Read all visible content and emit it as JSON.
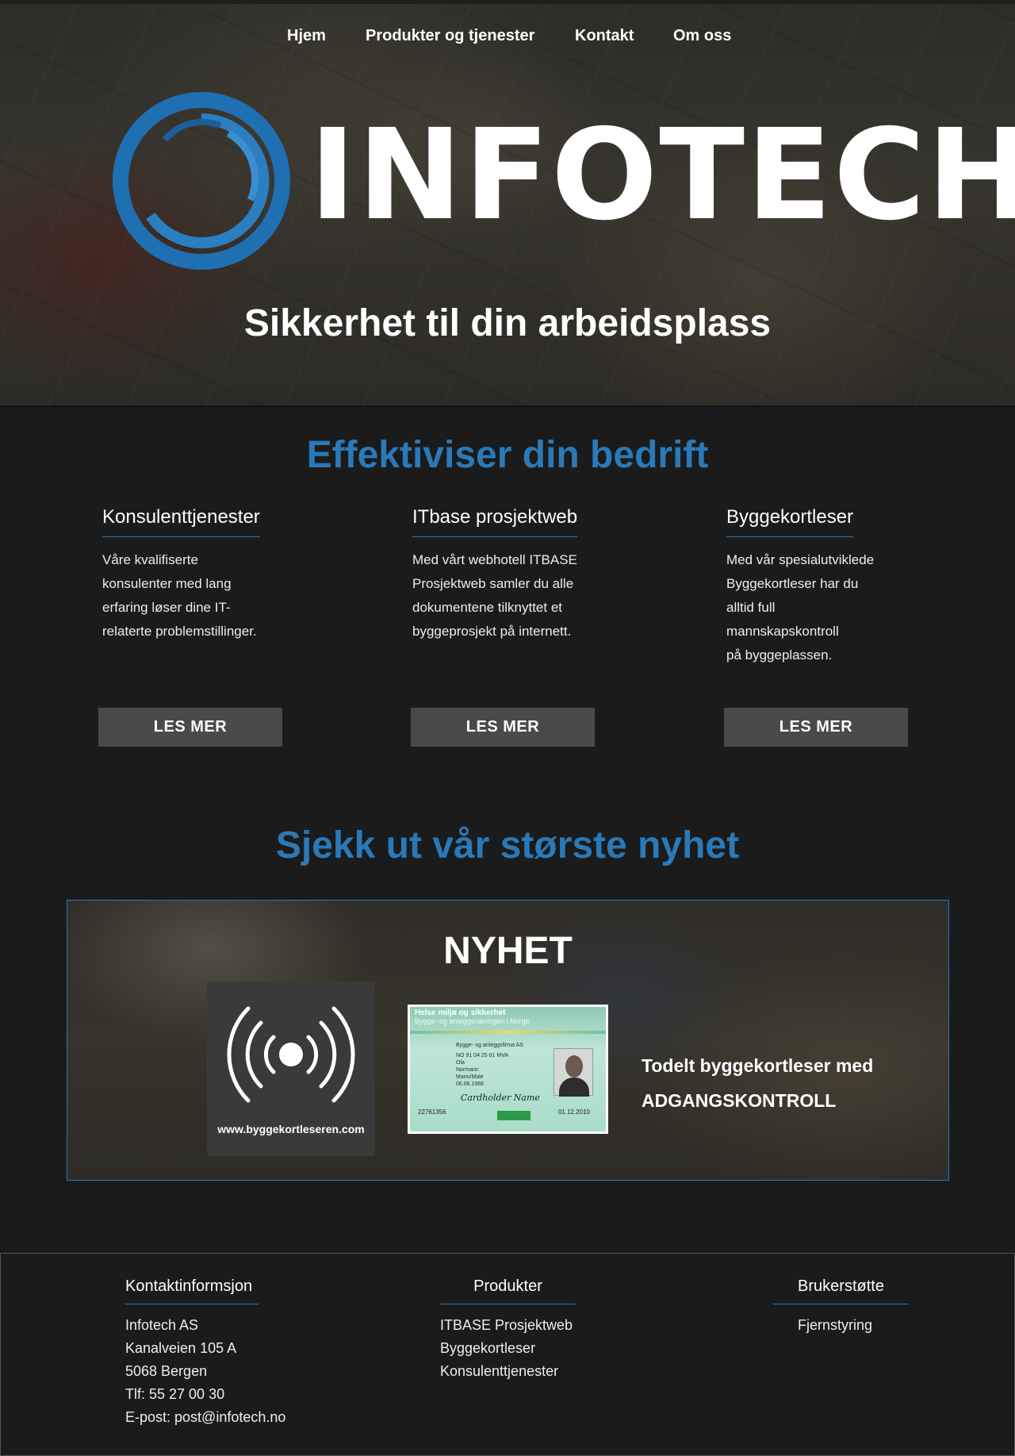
{
  "nav": {
    "items": [
      "Hjem",
      "Produkter og tjenester",
      "Kontakt",
      "Om oss"
    ]
  },
  "hero": {
    "logo_text": "INFOTECH",
    "tagline": "Sikkerhet til din arbeidsplass"
  },
  "services": {
    "title": "Effektiviser din bedrift",
    "items": [
      {
        "heading": "Konsulenttjenester",
        "lines": [
          "Våre kvalifiserte",
          "konsulenter med lang",
          "erfaring løser dine IT-",
          "relaterte problemstillinger."
        ],
        "button": "LES MER"
      },
      {
        "heading": "ITbase prosjektweb",
        "lines": [
          "Med vårt webhotell ITBASE",
          "Prosjektweb samler du alle",
          "dokumentene tilknyttet et",
          "byggeprosjekt på internett."
        ],
        "button": "LES MER"
      },
      {
        "heading": "Byggekortleser",
        "lines": [
          "Med vår spesialutviklede",
          "Byggekortleser har du",
          "alltid full",
          "mannskapskontroll",
          "på byggeplassen."
        ],
        "button": "LES MER"
      }
    ]
  },
  "news": {
    "title": "Sjekk ut vår største nyhet",
    "badge": "NYHET",
    "tile_url": "www.byggekortleseren.com",
    "card": {
      "top1": "Helse miljø og sikkerhet",
      "top2": "Bygge- og anleggsnæringen i Norge",
      "company": "Bygge- og anleggsfirma AS",
      "org": "NO 91 04 25 61 MVA",
      "first": "Ola",
      "last": "Normann",
      "gender": "Mann/Male",
      "dob": "06.06.1966",
      "signature": "Cardholder Name",
      "number": "22761356",
      "expiry": "01.12.2010"
    },
    "text_line1": "Todelt byggekortleser med",
    "text_line2": "ADGANGSKONTROLL"
  },
  "footer": {
    "contact": {
      "heading": "Kontaktinformsjon",
      "lines": [
        "Infotech AS",
        "Kanalveien 105 A",
        "5068 Bergen",
        "Tlf: 55 27 00 30",
        "E-post: post@infotech.no"
      ]
    },
    "products": {
      "heading": "Produkter",
      "lines": [
        "ITBASE Prosjektweb",
        "Byggekortleser",
        "Konsulenttjenester"
      ]
    },
    "support": {
      "heading": "Brukerstøtte",
      "lines": [
        "Fjernstyring"
      ]
    }
  },
  "colors": {
    "accent_blue": "#2a79b8",
    "background": "#1b1b1b",
    "button_gray": "#4a4a4a"
  }
}
